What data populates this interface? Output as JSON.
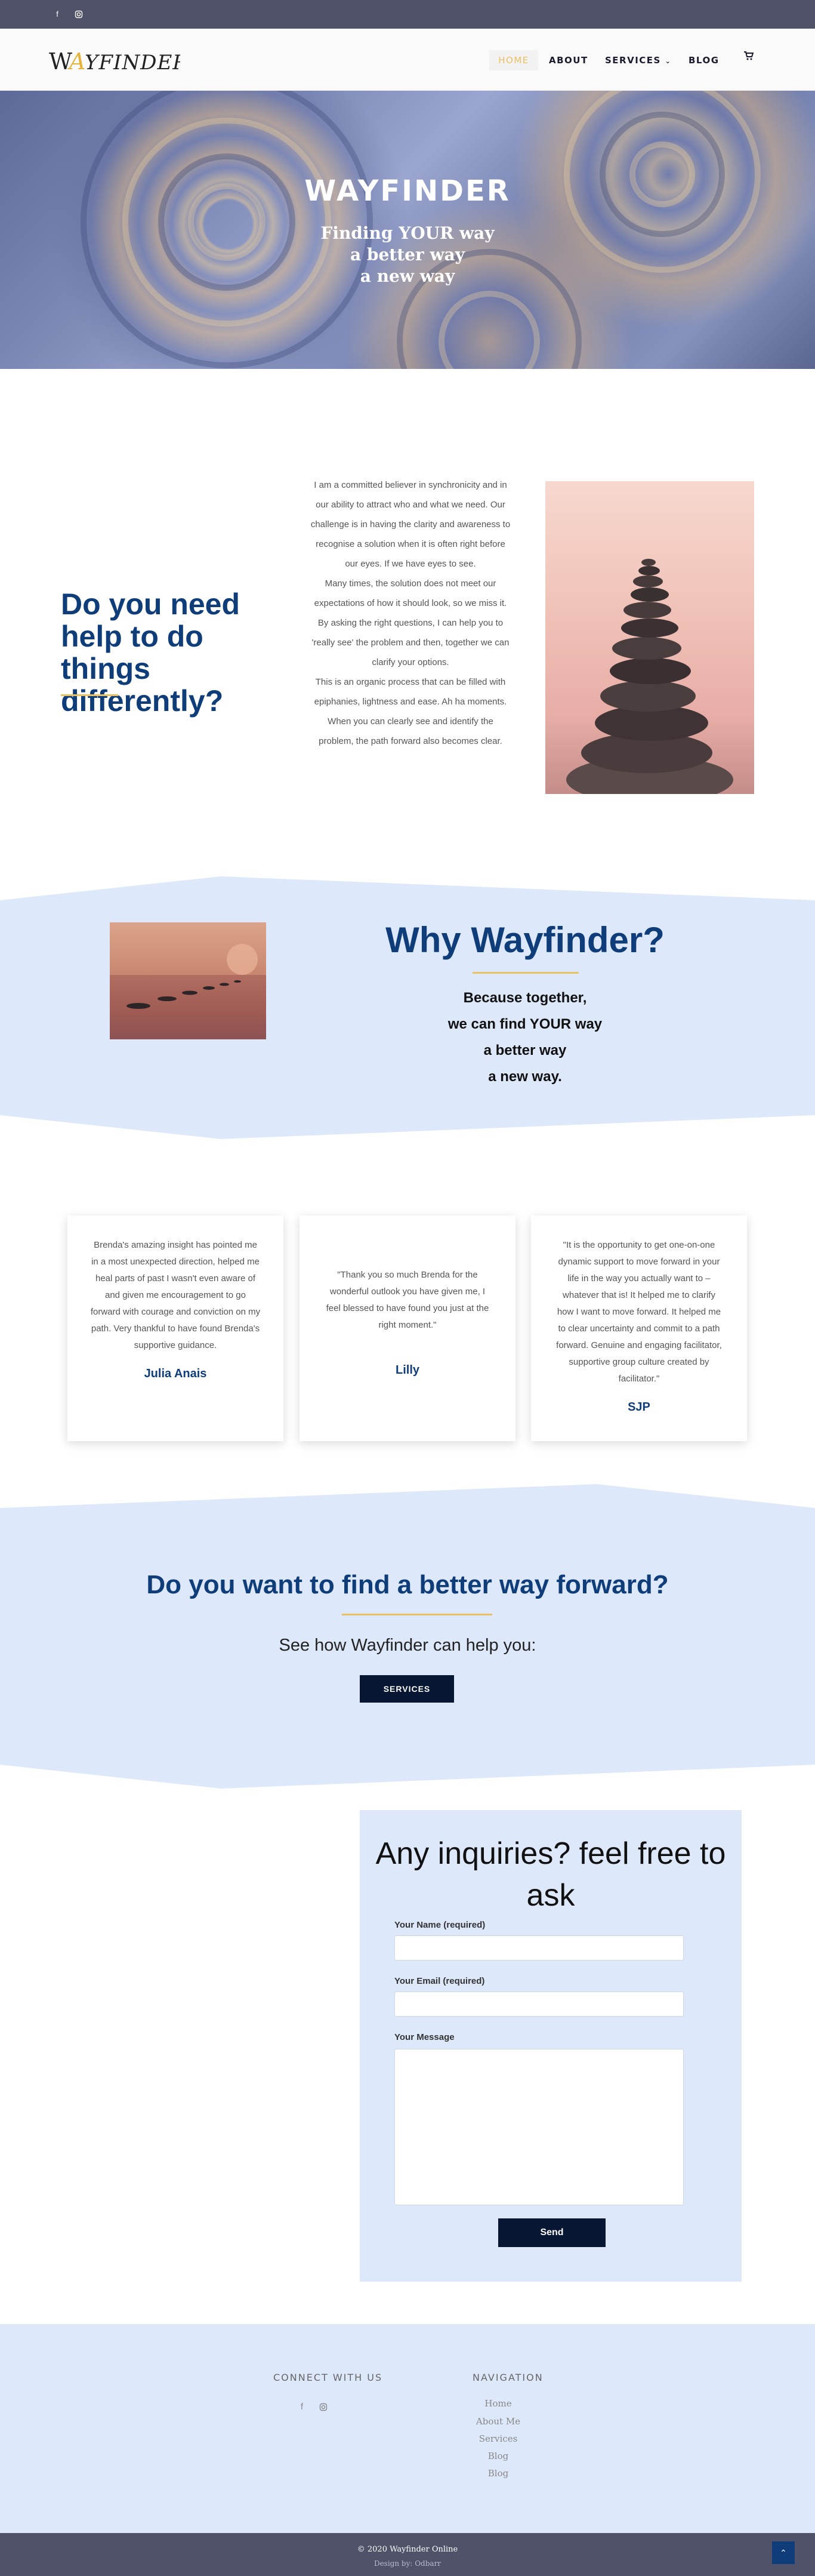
{
  "social": {
    "facebook_icon": "facebook-icon",
    "instagram_icon": "instagram-icon"
  },
  "header": {
    "logo": "WAYFINDER",
    "nav": [
      {
        "label": "HOME"
      },
      {
        "label": "ABOUT"
      },
      {
        "label": "SERVICES"
      },
      {
        "label": "BLOG"
      }
    ],
    "cart_icon": "cart-icon"
  },
  "hero": {
    "title": "WAYFINDER",
    "lines": [
      "Finding YOUR way",
      "a better way",
      "a new way"
    ]
  },
  "intro": {
    "heading": "Do you need help to do things differently?",
    "paragraphs": [
      "I am a committed believer in synchronicity and in our ability to attract who and what we need. Our challenge is in having the clarity and awareness to recognise a solution when it is often right before our eyes. If we have eyes to see.",
      "Many times, the solution does not meet our expectations of how it should look, so we miss it.",
      "By asking the right questions, I can help you to 'really see' the problem and then, together we can clarify your options.",
      "This is an organic process that can be filled with epiphanies, lightness and ease. Ah ha moments. When you can clearly see and identify the problem, the path forward also becomes clear."
    ]
  },
  "why": {
    "title": "Why Wayfinder?",
    "lines": [
      "Because together,",
      "we can find YOUR way",
      "a better way",
      "a new way."
    ]
  },
  "testimonials": [
    {
      "text": "Brenda's amazing insight has pointed me in a most unexpected direction, helped me heal parts of past I wasn't even aware of and given me encouragement to go forward with courage and conviction on my path. Very thankful to have found Brenda's supportive guidance.",
      "name": "Julia Anais"
    },
    {
      "text": "\"Thank you so much Brenda for the wonderful outlook you have given me, I feel blessed to have found you just at the right moment.\"",
      "name": "Lilly"
    },
    {
      "text": "\"It is the opportunity to get one-on-one dynamic support to move forward in your life in the way you actually want to – whatever that is! It helped me to clarify how I want to move forward. It helped me to clear uncertainty and commit to a path forward. Genuine and engaging facilitator, supportive group culture created by facilitator.\"",
      "name": "SJP"
    }
  ],
  "cta": {
    "title": "Do you want to find a better way forward?",
    "subtitle": "See how Wayfinder can help you:",
    "button": "SERVICES"
  },
  "form": {
    "title": "Any inquiries? feel free to ask",
    "name_label": "Your Name (required)",
    "email_label": "Your Email (required)",
    "message_label": "Your Message",
    "submit": "Send"
  },
  "footer": {
    "connect_heading": "CONNECT WITH US",
    "nav_heading": "NAVIGATION",
    "links": [
      "Home",
      "About Me",
      "Services",
      "Blog",
      "Blog"
    ],
    "copyright": "© 2020 Wayfinder Online",
    "credit": "Design by: Odbarr"
  },
  "colors": {
    "brand": "#0f3d7a",
    "accent": "#e9c162",
    "band": "#dde8fb",
    "dark": "#4f5268"
  }
}
